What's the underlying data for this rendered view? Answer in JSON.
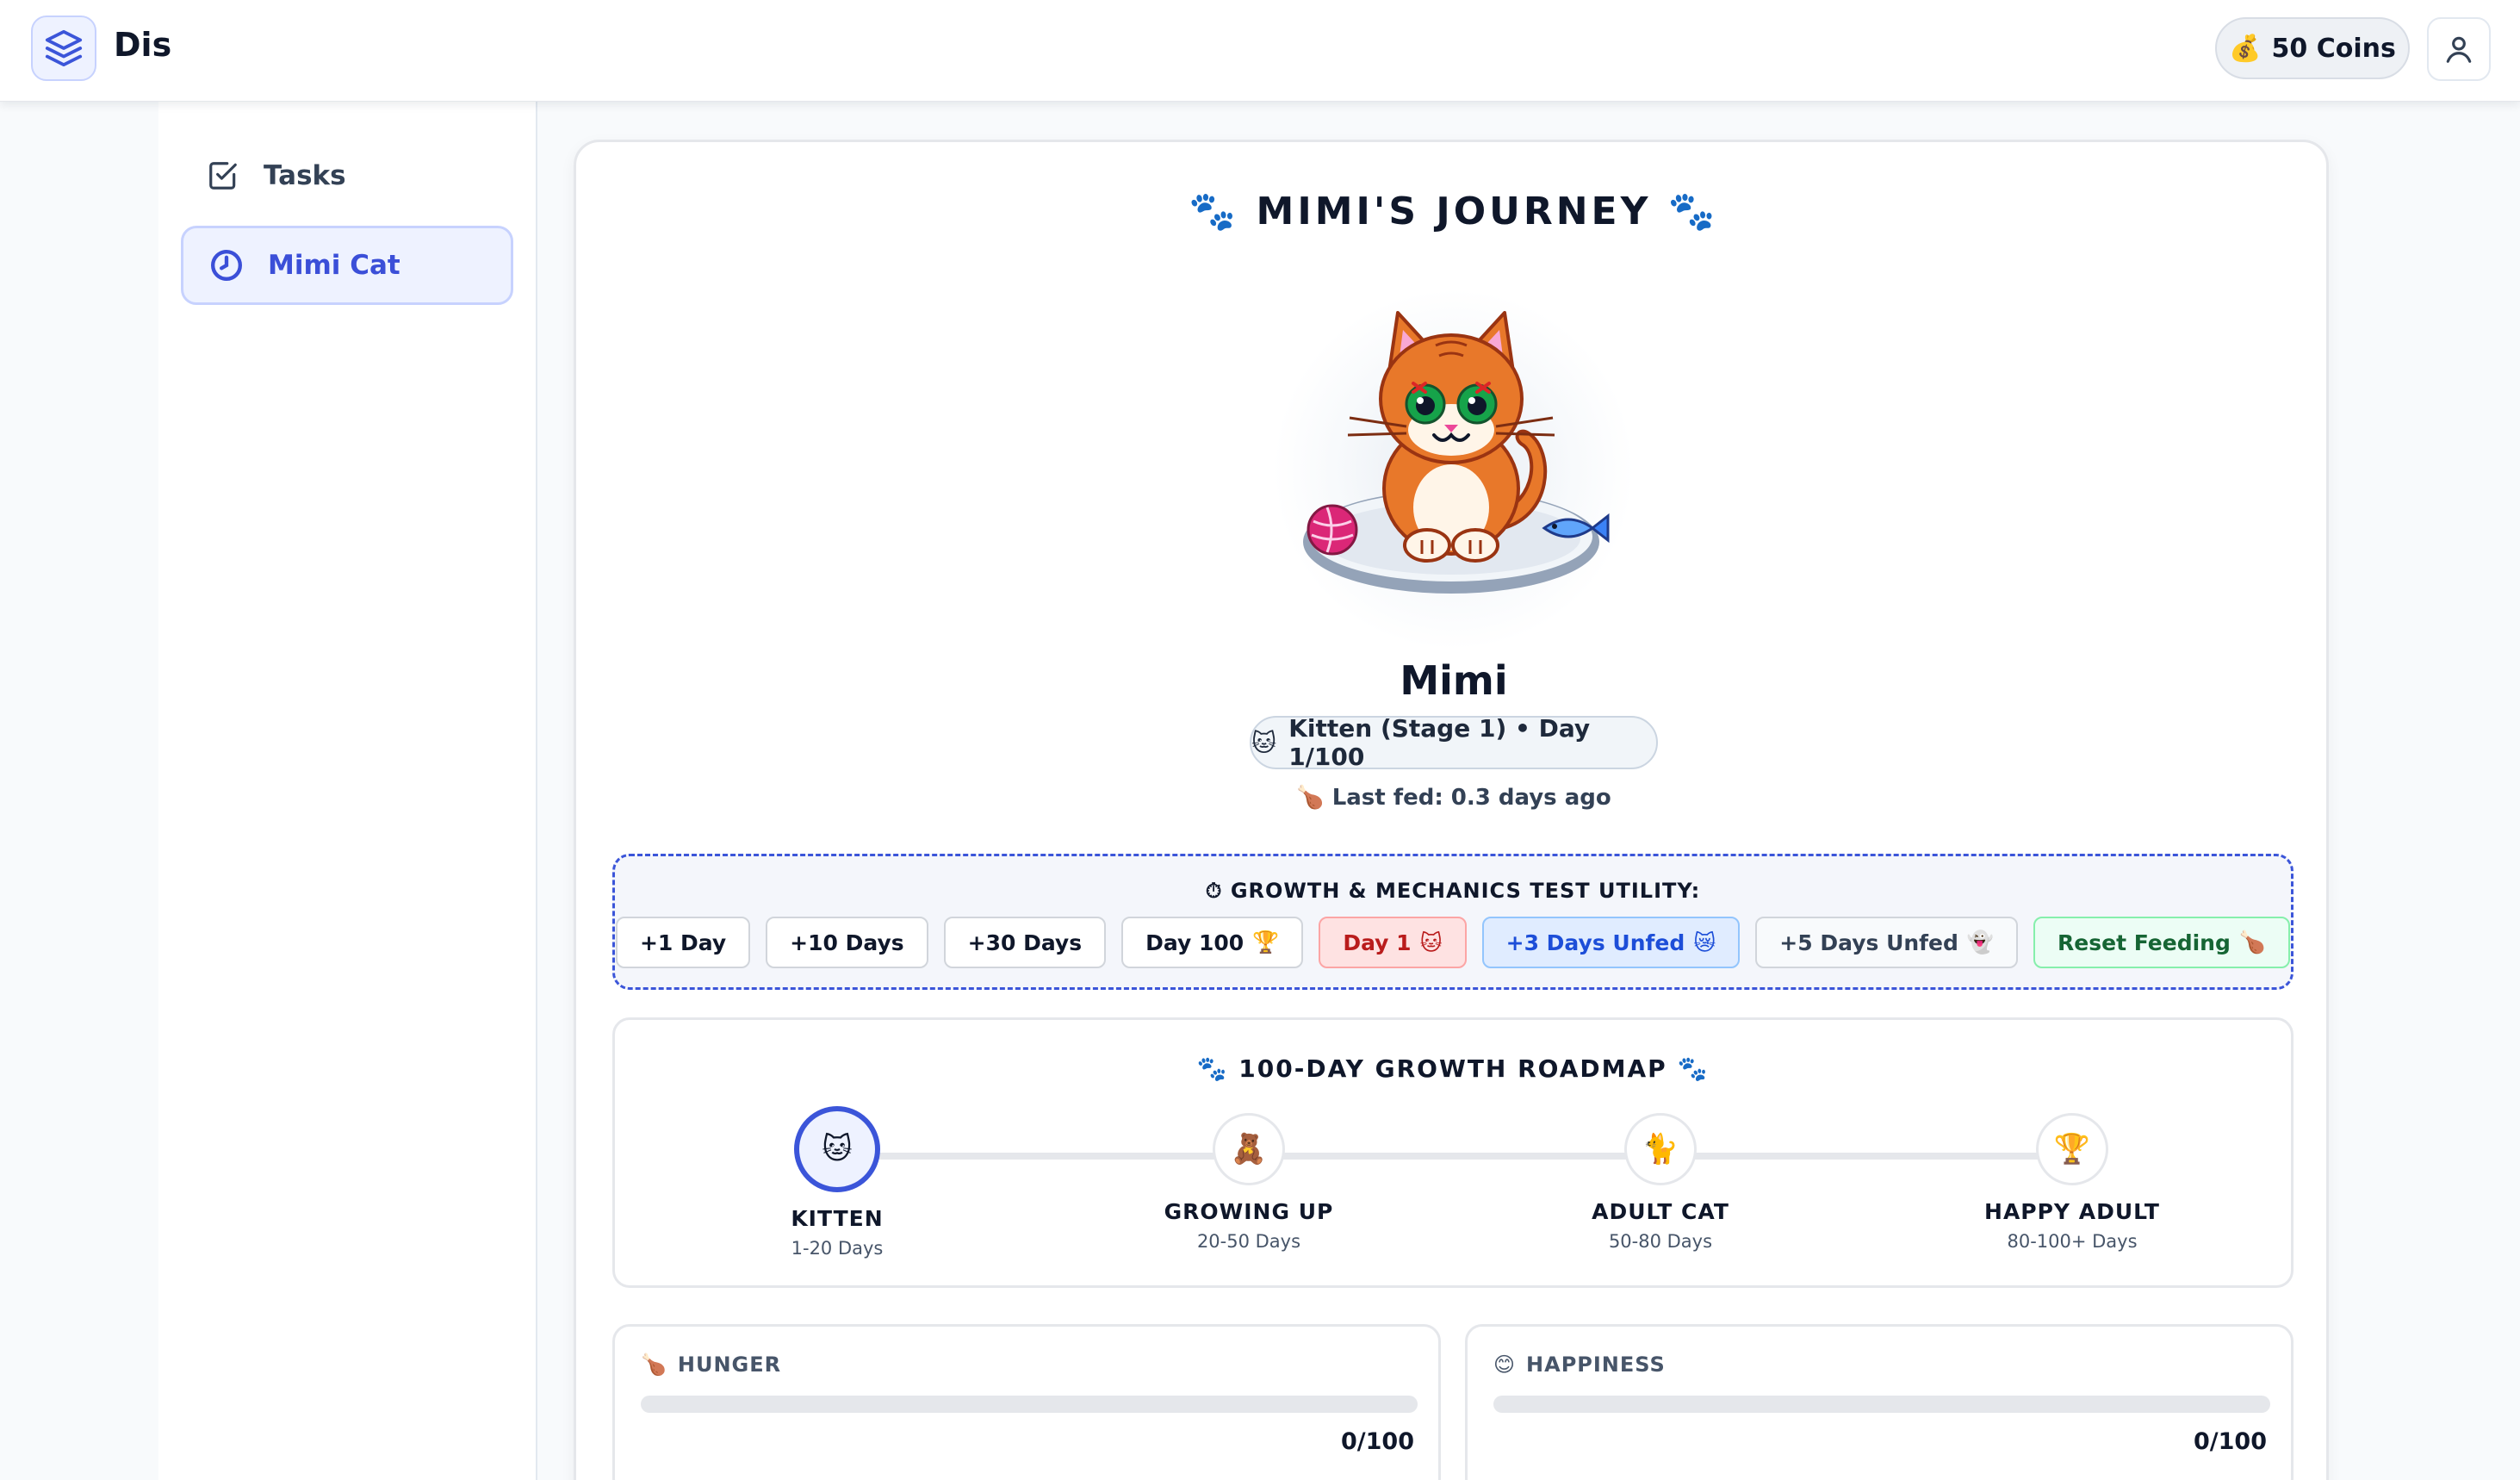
{
  "header": {
    "app_name": "Dis",
    "coins_icon": "money-bag-icon",
    "coins_label": "50 Coins"
  },
  "sidebar": {
    "items": [
      {
        "label": "Tasks",
        "icon": "checkbox-icon",
        "active": false
      },
      {
        "label": "Mimi Cat",
        "icon": "clock-icon",
        "active": true
      }
    ]
  },
  "pet": {
    "journey_title": "MIMI'S JOURNEY",
    "name": "Mimi",
    "stage_emoji": "🐱",
    "stage_text": "Kitten (Stage 1) • Day 1/100",
    "last_fed_emoji": "🍗",
    "last_fed_text": "Last fed: 0.3 days ago"
  },
  "test_utility": {
    "icon": "⏱",
    "title": "GROWTH & MECHANICS TEST UTILITY:",
    "buttons": [
      {
        "label": "+1 Day",
        "emoji": ""
      },
      {
        "label": "+10 Days",
        "emoji": ""
      },
      {
        "label": "+30 Days",
        "emoji": ""
      },
      {
        "label": "Day 100",
        "emoji": "🏆"
      },
      {
        "label": "Day 1",
        "emoji": "🐱"
      },
      {
        "label": "+3 Days Unfed",
        "emoji": "😿"
      },
      {
        "label": "+5 Days Unfed",
        "emoji": "👻"
      },
      {
        "label": "Reset Feeding",
        "emoji": "🍗"
      }
    ]
  },
  "roadmap": {
    "title": "100-DAY GROWTH ROADMAP",
    "milestones": [
      {
        "emoji": "🐱",
        "label": "KITTEN",
        "days": "1-20 Days",
        "active": true
      },
      {
        "emoji": "🧸",
        "label": "GROWING UP",
        "days": "20-50 Days",
        "active": false
      },
      {
        "emoji": "🐈",
        "label": "ADULT CAT",
        "days": "50-80 Days",
        "active": false
      },
      {
        "emoji": "🏆",
        "label": "HAPPY ADULT",
        "days": "80-100+ Days",
        "active": false
      }
    ]
  },
  "stats": {
    "hunger": {
      "emoji": "🍗",
      "label": "HUNGER",
      "value_text": "0/100",
      "value": 0
    },
    "happiness": {
      "emoji": "😊",
      "label": "HAPPINESS",
      "value_text": "0/100",
      "value": 0
    }
  },
  "colors": {
    "accent": "#3b55d9",
    "accent_light": "#eef2ff",
    "cat_orange": "#e8782a"
  }
}
